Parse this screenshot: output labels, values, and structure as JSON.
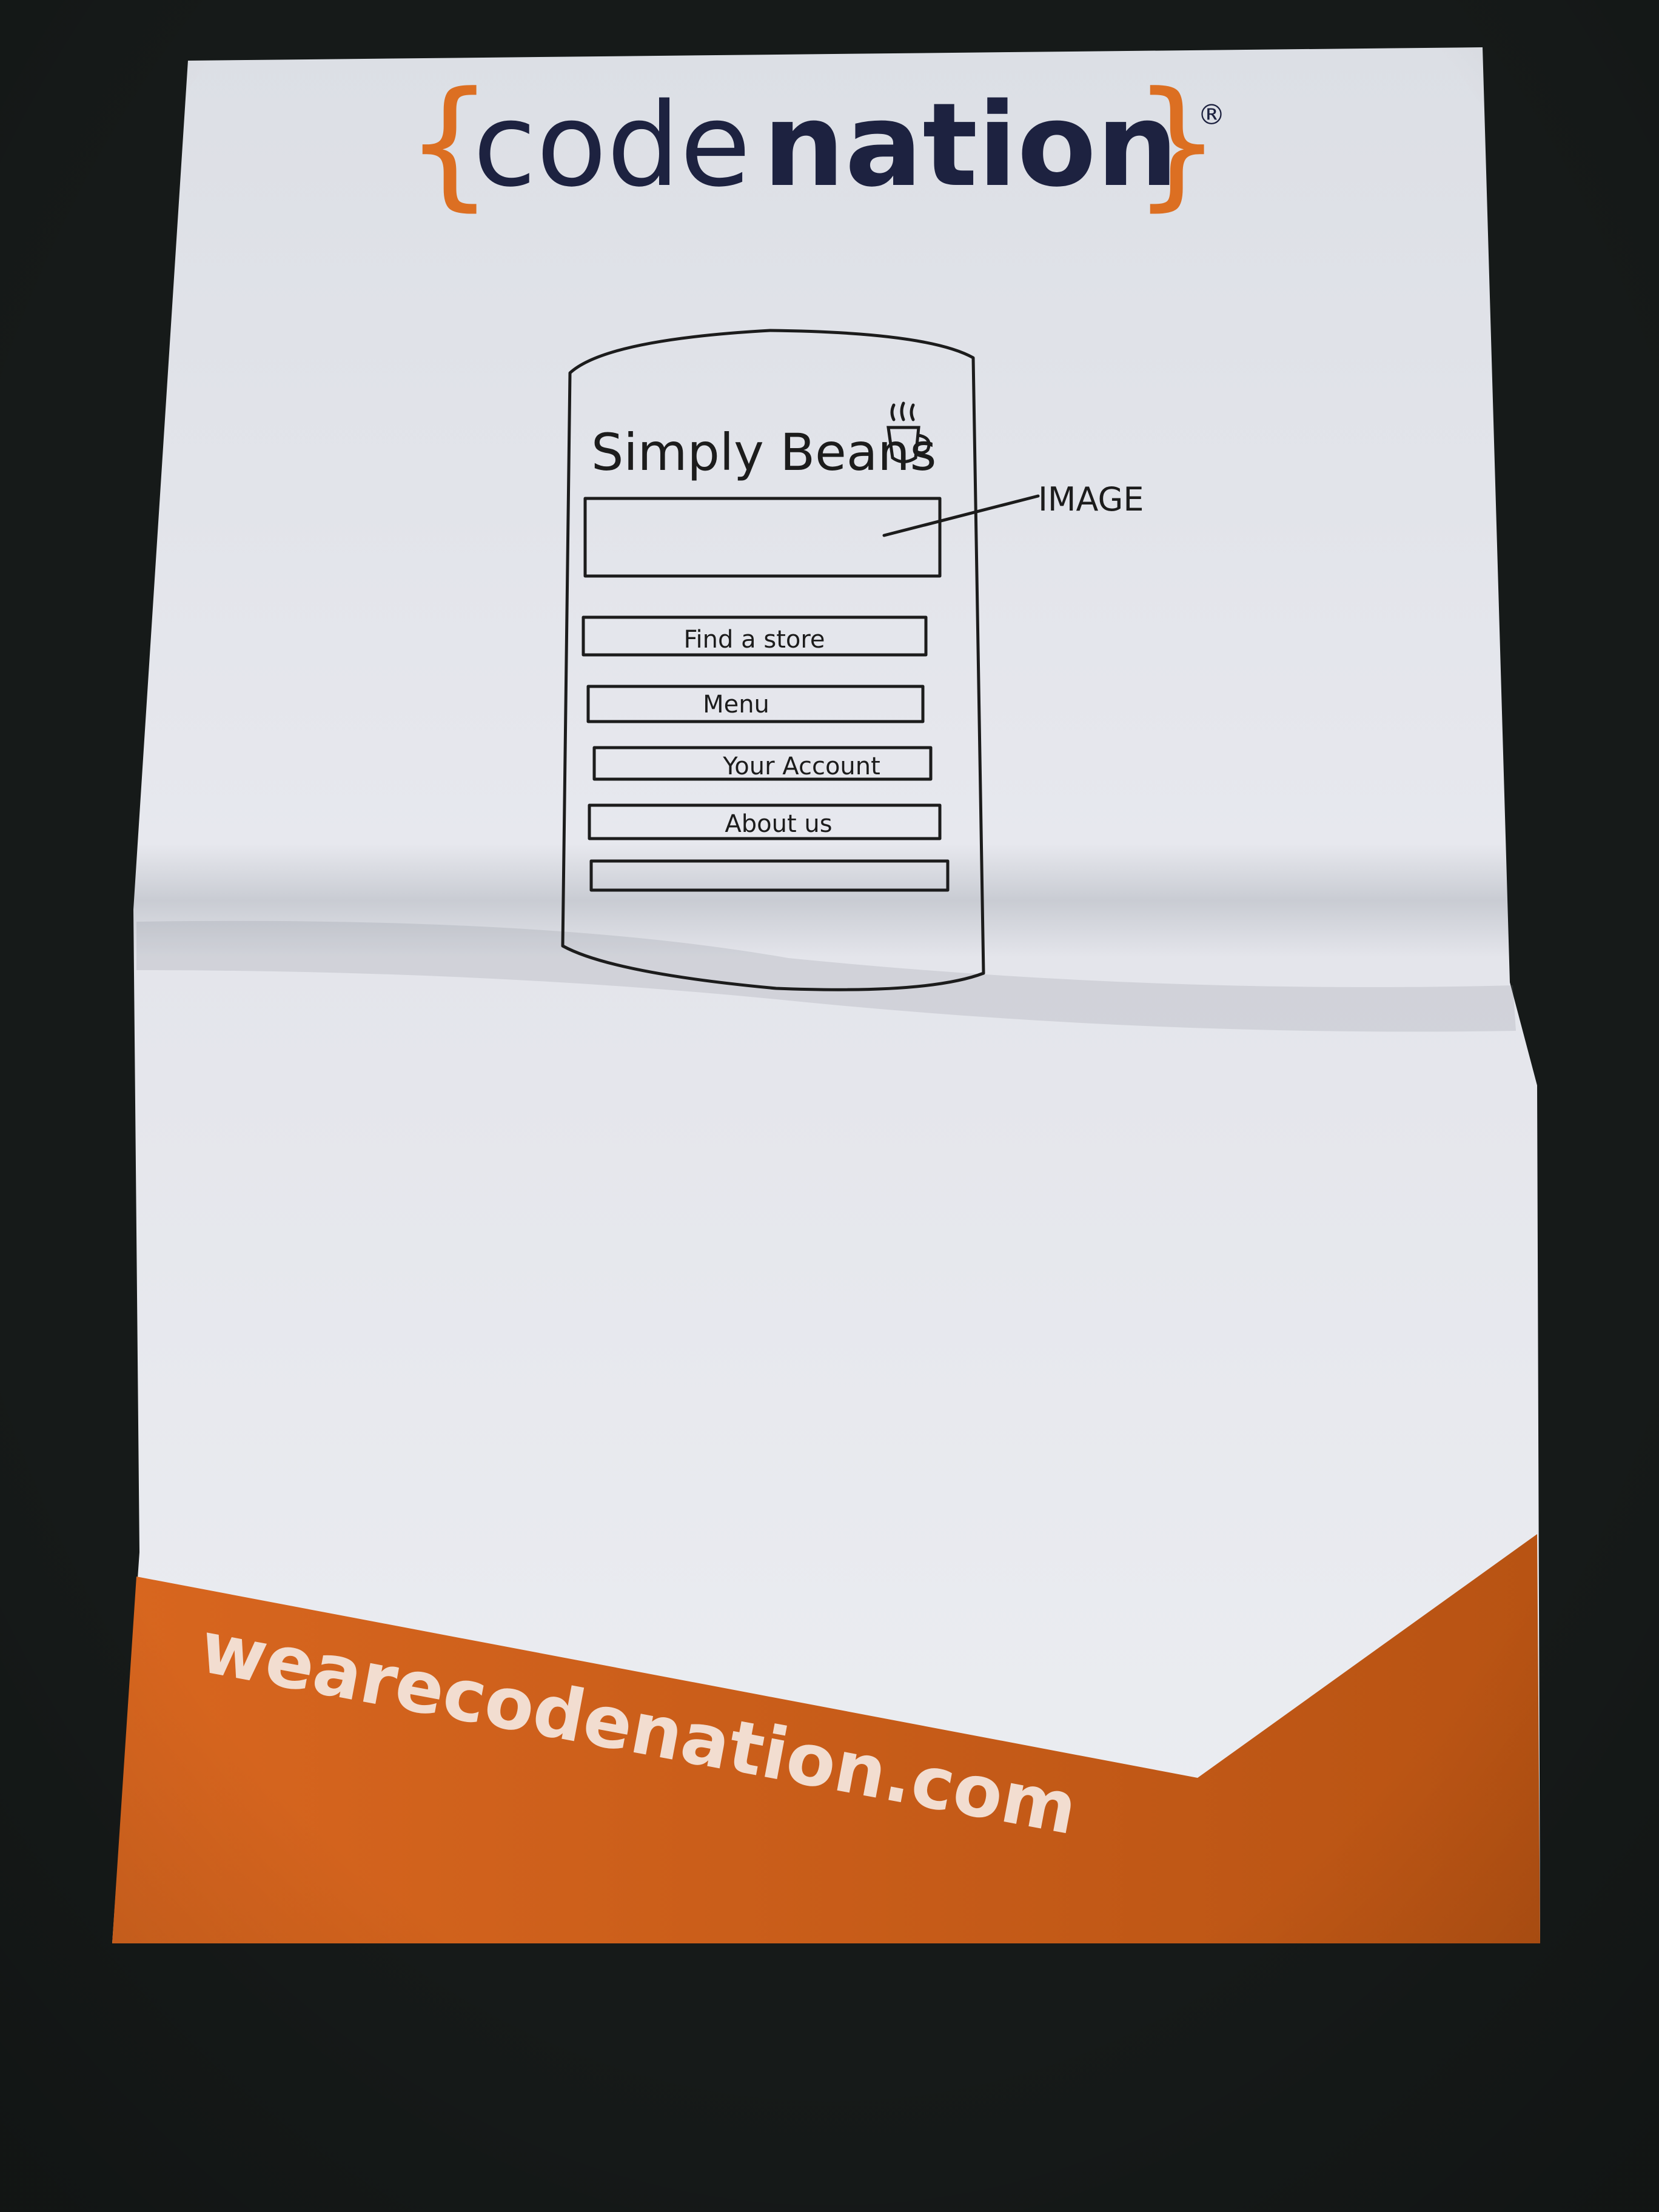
{
  "logo": {
    "brace_open": "{",
    "wordmark_light": "code",
    "wordmark_bold": "nation",
    "brace_close": "}",
    "registered": "®"
  },
  "sketch": {
    "app_title": "Simply Beans",
    "image_label": "IMAGE",
    "menu_buttons": [
      "Find a store",
      "Menu",
      "Your Account",
      "About us",
      ""
    ]
  },
  "footer": {
    "url": "wearecodenation.com"
  },
  "colors": {
    "brand_orange": "#dc6f22",
    "brand_navy": "#1d2240",
    "paper": "#e6e7ec",
    "background": "#161a19",
    "ink": "#1c1c1c"
  },
  "icons": {
    "coffee_cup": "coffee-cup-icon"
  }
}
